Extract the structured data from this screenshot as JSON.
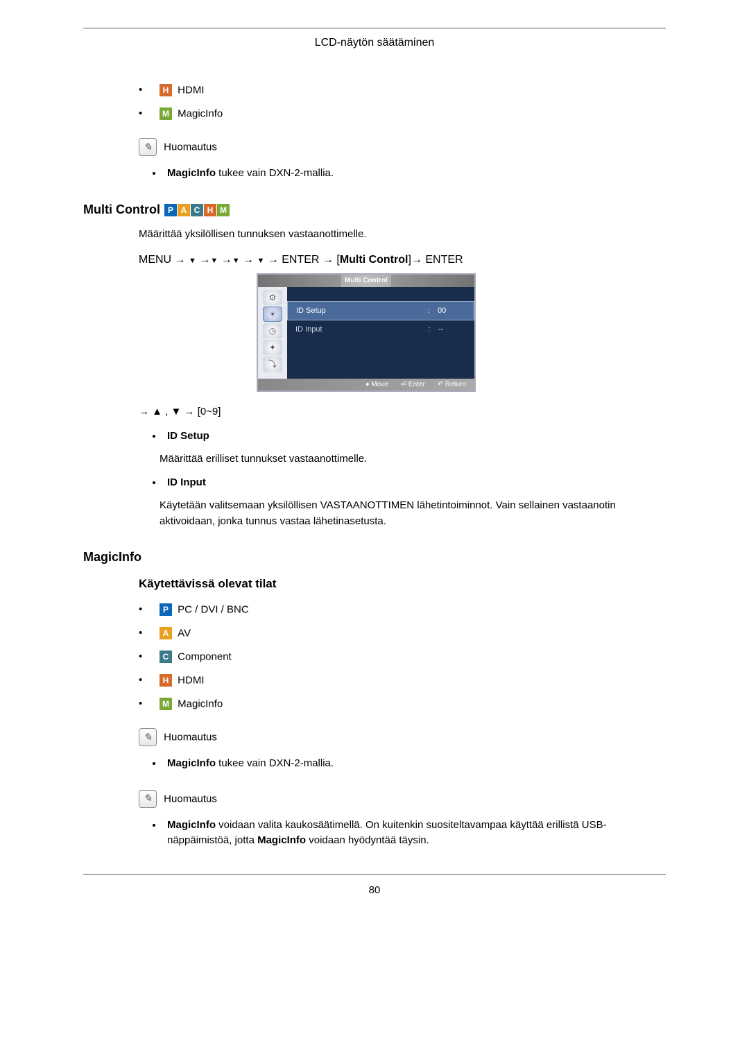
{
  "header": {
    "title": "LCD-näytön säätäminen"
  },
  "top_list": [
    {
      "icon": "H",
      "icon_class": "icon-h",
      "name": "hdmi",
      "label": "HDMI"
    },
    {
      "icon": "M",
      "icon_class": "icon-m",
      "name": "magicinfo",
      "label": "MagicInfo"
    }
  ],
  "note1": {
    "label": "Huomautus",
    "items": [
      {
        "bold": "MagicInfo",
        "rest": " tukee vain DXN-2-mallia."
      }
    ]
  },
  "multi_control": {
    "heading": "Multi Control",
    "description": "Määrittää yksilöllisen tunnuksen vastaanottimelle.",
    "menupath_prefix": "MENU → ",
    "menupath_mid": " → ENTER → [",
    "menupath_bracket_label": "Multi Control",
    "menupath_suffix": "]→ ENTER",
    "osd": {
      "title": "Multi Control",
      "rows": [
        {
          "label": "ID Setup",
          "sep": ":",
          "value": "00",
          "selected": true
        },
        {
          "label": "ID Input",
          "sep": ":",
          "value": "--",
          "selected": false
        }
      ],
      "footer": {
        "move": "Move",
        "enter": "Enter",
        "return": "Return"
      }
    },
    "range_line": "→ ▲ , ▼ → [0~9]",
    "subitems": [
      {
        "title": "ID Setup",
        "desc": "Määrittää erilliset tunnukset vastaanottimelle."
      },
      {
        "title": "ID Input",
        "desc": "Käytetään valitsemaan yksilöllisen VASTAANOTTIMEN lähetintoiminnot. Vain sellainen vastaanotin aktivoidaan, jonka tunnus vastaa lähetinasetusta."
      }
    ]
  },
  "magicinfo": {
    "heading": "MagicInfo",
    "subheading": "Käytettävissä olevat tilat",
    "modes": [
      {
        "icon": "P",
        "icon_class": "icon-p",
        "name": "pc",
        "label": "PC / DVI / BNC"
      },
      {
        "icon": "A",
        "icon_class": "icon-a",
        "name": "av",
        "label": "AV"
      },
      {
        "icon": "C",
        "icon_class": "icon-c",
        "name": "component",
        "label": "Component"
      },
      {
        "icon": "H",
        "icon_class": "icon-h",
        "name": "hdmi",
        "label": "HDMI"
      },
      {
        "icon": "M",
        "icon_class": "icon-m",
        "name": "magicinfo",
        "label": "MagicInfo"
      }
    ],
    "note2": {
      "label": "Huomautus",
      "items": [
        {
          "bold": "MagicInfo",
          "rest": " tukee vain DXN-2-mallia."
        }
      ]
    },
    "note3": {
      "label": "Huomautus",
      "items": [
        {
          "html": "<b>MagicInfo</b> voidaan valita kaukosäätimellä. On kuitenkin suositeltavampaa käyttää erillistä USB-näppäimistöä, jotta <b>MagicInfo</b> voidaan hyödyntää täysin."
        }
      ]
    }
  },
  "page_number": "80"
}
